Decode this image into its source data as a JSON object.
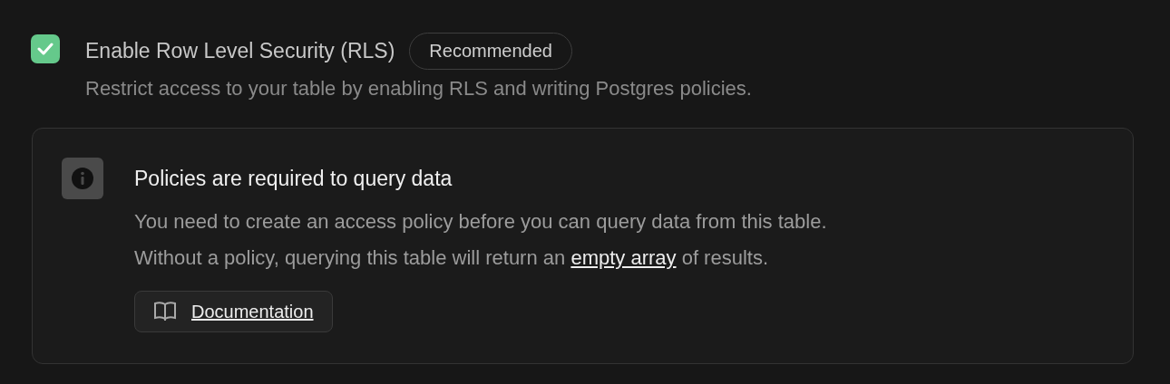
{
  "rls": {
    "checked": true,
    "label": "Enable Row Level Security (RLS)",
    "badge": "Recommended",
    "description": "Restrict access to your table by enabling RLS and writing Postgres policies."
  },
  "notice": {
    "title": "Policies are required to query data",
    "line_1": "You need to create an access policy before you can query data from this table.",
    "line_2_before": "Without a policy, querying this table will return an ",
    "link": "empty array",
    "line_2_after": " of results.",
    "button": "Documentation"
  }
}
